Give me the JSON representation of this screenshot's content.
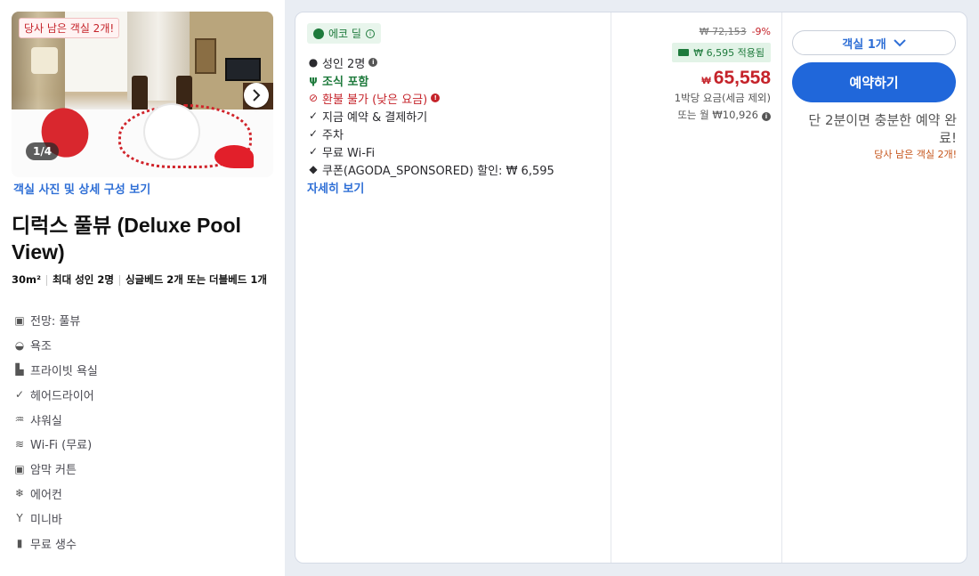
{
  "left": {
    "rooms_left_badge": "당사 남은 객실 2개!",
    "photo_counter": "1/4",
    "photo_link": "객실 사진 및 상세 구성 보기",
    "room_title": "디럭스 풀뷰 (Deluxe Pool View)",
    "meta": {
      "size": "30m²",
      "max_guests": "최대 성인 2명",
      "beds": "싱글베드 2개 또는 더블베드 1개"
    },
    "amenities": [
      {
        "icon": "view-icon",
        "label": "전망: 풀뷰"
      },
      {
        "icon": "bathtub-icon",
        "label": "욕조"
      },
      {
        "icon": "private-bathroom-icon",
        "label": "프라이빗 욕실"
      },
      {
        "icon": "check-icon",
        "label": "헤어드라이어"
      },
      {
        "icon": "shower-icon",
        "label": "샤워실"
      },
      {
        "icon": "wifi-icon",
        "label": "Wi-Fi (무료)"
      },
      {
        "icon": "blackout-curtain-icon",
        "label": "암막 커튼"
      },
      {
        "icon": "air-conditioner-icon",
        "label": "에어컨"
      },
      {
        "icon": "minibar-icon",
        "label": "미니바"
      },
      {
        "icon": "water-bottle-icon",
        "label": "무료 생수"
      }
    ]
  },
  "offer": {
    "eco_deal": "에코 딜",
    "features": {
      "guests": "성인 2명",
      "breakfast": "조식 포함",
      "refund": "환불 불가 (낮은 요금)",
      "pay_now": "지금 예약 & 결제하기",
      "parking": "주차",
      "wifi": "무료 Wi-Fi",
      "coupon": "쿠폰(AGODA_SPONSORED) 할인: ₩ 6,595"
    },
    "more_link": "자세히 보기"
  },
  "price": {
    "original": "₩ 72,153",
    "discount": "-9%",
    "coupon_applied": "₩ 6,595 적용됨",
    "currency": "₩",
    "amount": "65,558",
    "per_night": "1박당 요금(세금 제외)",
    "monthly": "또는 월 ₩10,926"
  },
  "action": {
    "room_select": "객실 1개",
    "book_button": "예약하기",
    "quick_note": "단 2분이면 충분한 예약 완료!",
    "rooms_left": "당사 남은 객실 2개!"
  },
  "colors": {
    "accent_blue": "#2067da",
    "link_blue": "#2f6fd6",
    "price_red": "#c5232a",
    "eco_green": "#1e7a3c"
  }
}
